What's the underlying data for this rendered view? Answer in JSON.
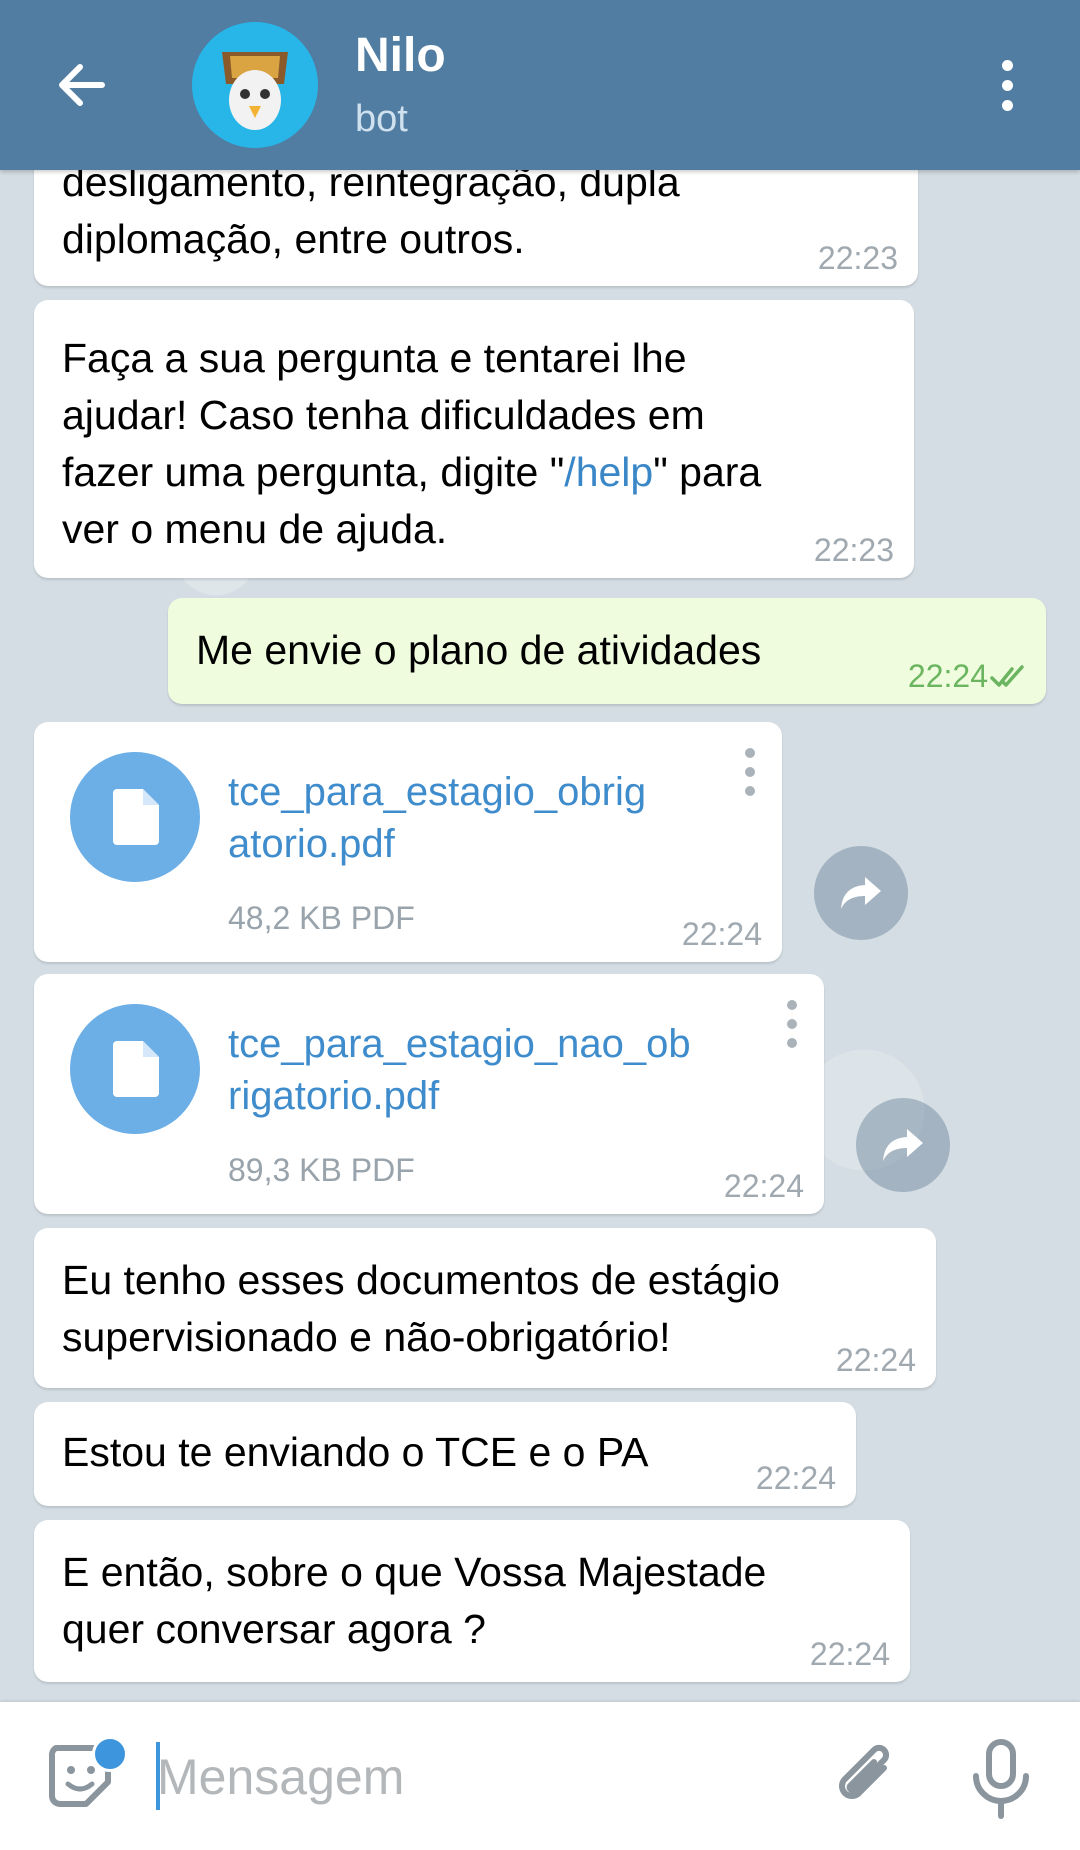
{
  "header": {
    "title": "Nilo",
    "subtitle": "bot"
  },
  "messages": [
    {
      "lines": [
        "desligamento, reintegração, dupla",
        "diplomação, entre outros."
      ],
      "time": "22:23"
    },
    {
      "line1": "Faça a sua pergunta e tentarei lhe",
      "line2": "ajudar! Caso tenha dificuldades em",
      "line3_pre": "fazer uma pergunta, digite \"",
      "line3_cmd": "/help",
      "line3_post": "\" para",
      "line4": "ver o menu de ajuda.",
      "time": "22:23"
    },
    {
      "text": "Me envie o plano de atividades",
      "time": "22:24"
    },
    {
      "file_name_1": "tce_para_estagio_obrig",
      "file_name_2": "atorio.pdf",
      "size": "48,2 KB PDF",
      "time": "22:24"
    },
    {
      "file_name_1": "tce_para_estagio_nao_ob",
      "file_name_2": "rigatorio.pdf",
      "size": "89,3 KB PDF",
      "time": "22:24"
    },
    {
      "lines": [
        "Eu tenho esses documentos de estágio",
        "supervisionado e não-obrigatório!"
      ],
      "time": "22:24"
    },
    {
      "text": "Estou te enviando o TCE e o PA",
      "time": "22:24"
    },
    {
      "lines": [
        "E então, sobre o que Vossa Majestade",
        "quer conversar agora ?"
      ],
      "time": "22:24"
    }
  ],
  "input": {
    "placeholder": "Mensagem"
  },
  "colors": {
    "header": "#517da2",
    "outgoing_bubble": "#effdde",
    "link": "#3a87c8",
    "file_icon": "#6caee6"
  },
  "icons": [
    "back-arrow-icon",
    "more-vert-icon",
    "document-icon",
    "share-icon",
    "sticker-icon",
    "paperclip-icon",
    "microphone-icon",
    "double-check-icon"
  ]
}
